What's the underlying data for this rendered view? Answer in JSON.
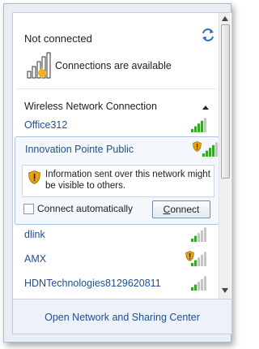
{
  "header": {
    "status": "Not connected",
    "available_text": "Connections are available"
  },
  "section": {
    "title": "Wireless Network Connection"
  },
  "networks": [
    {
      "name": "Office312",
      "secured": false,
      "signal_bars": 4
    },
    {
      "name": "Innovation Pointe Public",
      "secured": false,
      "warning": true,
      "signal_bars": 4,
      "selected": true
    },
    {
      "name": "dlink",
      "secured": false,
      "signal_bars": 2
    },
    {
      "name": "AMX",
      "secured": false,
      "warning": true,
      "signal_bars": 2
    },
    {
      "name": "HDNTechnologies8129620811",
      "secured": false,
      "signal_bars": 2
    }
  ],
  "selected_detail": {
    "warning_text": "Information sent over this network might be visible to others.",
    "auto_connect_label": "Connect automatically",
    "auto_connect_checked": false,
    "connect_label_first": "C",
    "connect_label_rest": "onnect"
  },
  "footer": {
    "link": "Open Network and Sharing Center"
  },
  "colors": {
    "link": "#1f4f8f",
    "signal_on": "#3aa52c",
    "signal_off": "#c4c4c4",
    "warning": "#e9a00d"
  }
}
